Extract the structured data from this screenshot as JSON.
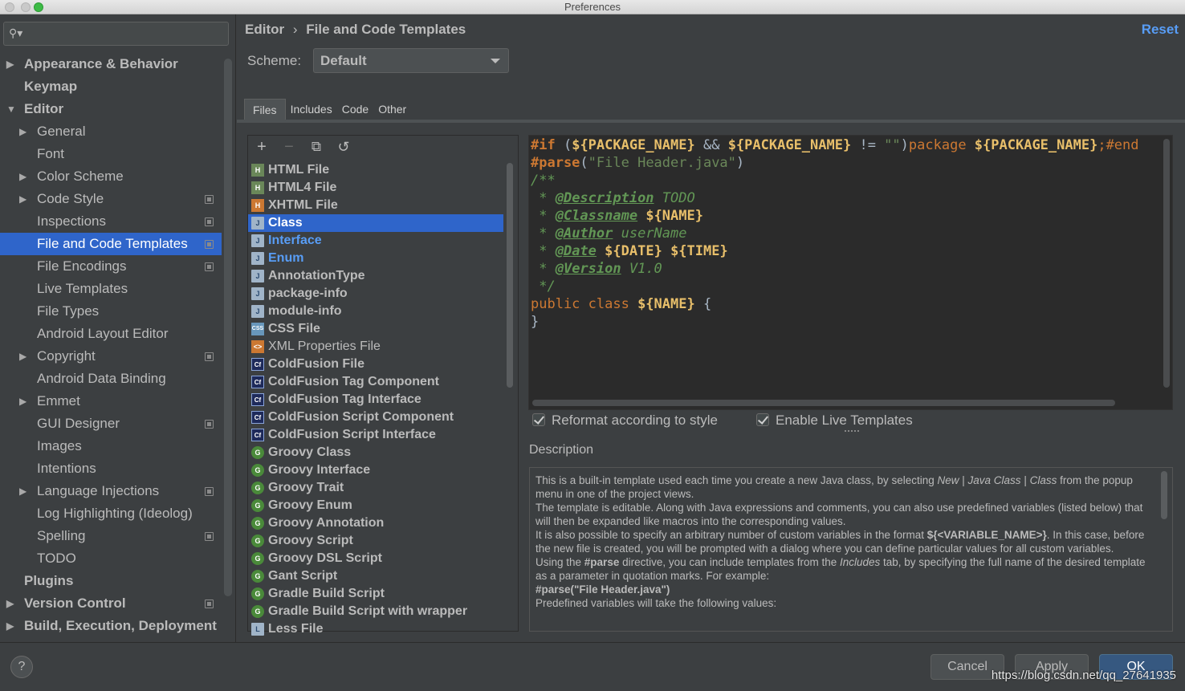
{
  "window": {
    "title": "Preferences"
  },
  "search": {
    "placeholder": ""
  },
  "sidebar": {
    "items": [
      {
        "label": "Appearance & Behavior",
        "bold": true,
        "arrow": "▶",
        "level": 0
      },
      {
        "label": "Keymap",
        "bold": true,
        "arrow": "",
        "level": 0
      },
      {
        "label": "Editor",
        "bold": true,
        "arrow": "▼",
        "level": 0
      },
      {
        "label": "General",
        "arrow": "▶",
        "level": 1
      },
      {
        "label": "Font",
        "arrow": "",
        "level": 1
      },
      {
        "label": "Color Scheme",
        "arrow": "▶",
        "level": 1
      },
      {
        "label": "Code Style",
        "arrow": "▶",
        "level": 1,
        "cfg": true
      },
      {
        "label": "Inspections",
        "arrow": "",
        "level": 1,
        "cfg": true
      },
      {
        "label": "File and Code Templates",
        "arrow": "",
        "level": 1,
        "cfg": true,
        "selected": true
      },
      {
        "label": "File Encodings",
        "arrow": "",
        "level": 1,
        "cfg": true
      },
      {
        "label": "Live Templates",
        "arrow": "",
        "level": 1
      },
      {
        "label": "File Types",
        "arrow": "",
        "level": 1
      },
      {
        "label": "Android Layout Editor",
        "arrow": "",
        "level": 1
      },
      {
        "label": "Copyright",
        "arrow": "▶",
        "level": 1,
        "cfg": true
      },
      {
        "label": "Android Data Binding",
        "arrow": "",
        "level": 1
      },
      {
        "label": "Emmet",
        "arrow": "▶",
        "level": 1
      },
      {
        "label": "GUI Designer",
        "arrow": "",
        "level": 1,
        "cfg": true
      },
      {
        "label": "Images",
        "arrow": "",
        "level": 1
      },
      {
        "label": "Intentions",
        "arrow": "",
        "level": 1
      },
      {
        "label": "Language Injections",
        "arrow": "▶",
        "level": 1,
        "cfg": true
      },
      {
        "label": "Log Highlighting (Ideolog)",
        "arrow": "",
        "level": 1
      },
      {
        "label": "Spelling",
        "arrow": "",
        "level": 1,
        "cfg": true
      },
      {
        "label": "TODO",
        "arrow": "",
        "level": 1
      },
      {
        "label": "Plugins",
        "bold": true,
        "arrow": "",
        "level": 0
      },
      {
        "label": "Version Control",
        "bold": true,
        "arrow": "▶",
        "level": 0,
        "cfg": true
      },
      {
        "label": "Build, Execution, Deployment",
        "bold": true,
        "arrow": "▶",
        "level": 0
      }
    ]
  },
  "header": {
    "breadcrumb_root": "Editor",
    "breadcrumb_sep": "›",
    "breadcrumb_page": "File and Code Templates",
    "reset_label": "Reset"
  },
  "scheme": {
    "label": "Scheme:",
    "value": "Default"
  },
  "tabs": [
    {
      "label": "Files",
      "active": true
    },
    {
      "label": "Includes"
    },
    {
      "label": "Code"
    },
    {
      "label": "Other"
    }
  ],
  "toolbar": {
    "add": "+",
    "remove": "−",
    "copy": "⧉",
    "revert": "↺"
  },
  "templates": [
    {
      "label": "HTML File",
      "icon": "html",
      "icon_text": "H"
    },
    {
      "label": "HTML4 File",
      "icon": "html4",
      "icon_text": "H"
    },
    {
      "label": "XHTML File",
      "icon": "xhtml",
      "icon_text": "H"
    },
    {
      "label": "Class",
      "icon": "java",
      "icon_text": "J",
      "selected": true
    },
    {
      "label": "Interface",
      "icon": "java",
      "icon_text": "J",
      "blue": true
    },
    {
      "label": "Enum",
      "icon": "java",
      "icon_text": "J",
      "blue": true
    },
    {
      "label": "AnnotationType",
      "icon": "java",
      "icon_text": "J"
    },
    {
      "label": "package-info",
      "icon": "java",
      "icon_text": "J"
    },
    {
      "label": "module-info",
      "icon": "java",
      "icon_text": "J"
    },
    {
      "label": "CSS File",
      "icon": "css",
      "icon_text": "CSS"
    },
    {
      "label": "XML Properties File",
      "icon": "xml",
      "icon_text": "<>",
      "plain": true
    },
    {
      "label": "ColdFusion File",
      "icon": "cf",
      "icon_text": "Cf"
    },
    {
      "label": "ColdFusion Tag Component",
      "icon": "cf",
      "icon_text": "Cf"
    },
    {
      "label": "ColdFusion Tag Interface",
      "icon": "cf",
      "icon_text": "Cf"
    },
    {
      "label": "ColdFusion Script Component",
      "icon": "cf",
      "icon_text": "Cf"
    },
    {
      "label": "ColdFusion Script Interface",
      "icon": "cf",
      "icon_text": "Cf"
    },
    {
      "label": "Groovy Class",
      "icon": "groovy",
      "icon_text": "G"
    },
    {
      "label": "Groovy Interface",
      "icon": "groovy",
      "icon_text": "G"
    },
    {
      "label": "Groovy Trait",
      "icon": "groovy",
      "icon_text": "G"
    },
    {
      "label": "Groovy Enum",
      "icon": "groovy",
      "icon_text": "G"
    },
    {
      "label": "Groovy Annotation",
      "icon": "groovy",
      "icon_text": "G"
    },
    {
      "label": "Groovy Script",
      "icon": "groovy",
      "icon_text": "G"
    },
    {
      "label": "Groovy DSL Script",
      "icon": "groovy",
      "icon_text": "G"
    },
    {
      "label": "Gant Script",
      "icon": "groovy",
      "icon_text": "G"
    },
    {
      "label": "Gradle Build Script",
      "icon": "groovy",
      "icon_text": "G"
    },
    {
      "label": "Gradle Build Script with wrapper",
      "icon": "groovy",
      "icon_text": "G"
    },
    {
      "label": "Less File",
      "icon": "java",
      "icon_text": "L"
    }
  ],
  "editor": {
    "lines": [
      [
        [
          "kw",
          "#if "
        ],
        [
          "op",
          "("
        ],
        [
          "var",
          "${PACKAGE_NAME}"
        ],
        [
          "op",
          " && "
        ],
        [
          "var",
          "${PACKAGE_NAME}"
        ],
        [
          "op",
          " != "
        ],
        [
          "str",
          "\"\""
        ],
        [
          "op",
          ")"
        ],
        [
          "dir",
          "package "
        ],
        [
          "var",
          "${PACKAGE_NAME}"
        ],
        [
          "dir",
          ";#end"
        ]
      ],
      [
        [
          "kw",
          "#parse"
        ],
        [
          "op",
          "("
        ],
        [
          "str",
          "\"File Header.java\""
        ],
        [
          "op",
          ")"
        ]
      ],
      [
        [
          "cm",
          "/**"
        ]
      ],
      [
        [
          "cm",
          " * "
        ],
        [
          "tag",
          "@Description"
        ],
        [
          "cm",
          " TODO"
        ]
      ],
      [
        [
          "cm",
          " * "
        ],
        [
          "tag",
          "@Classname"
        ],
        [
          "cm",
          " "
        ],
        [
          "var",
          "${NAME}"
        ]
      ],
      [
        [
          "cm",
          " * "
        ],
        [
          "tag",
          "@Author"
        ],
        [
          "cm",
          " userName"
        ]
      ],
      [
        [
          "cm",
          " * "
        ],
        [
          "tag",
          "@Date"
        ],
        [
          "cm",
          " "
        ],
        [
          "var",
          "${DATE}"
        ],
        [
          "cm",
          " "
        ],
        [
          "var",
          "${TIME}"
        ]
      ],
      [
        [
          "cm",
          " * "
        ],
        [
          "tag",
          "@Version"
        ],
        [
          "cm",
          " V1.0"
        ]
      ],
      [
        [
          "cm",
          " */"
        ]
      ],
      [
        [
          "dir",
          "public class "
        ],
        [
          "var",
          "${NAME}"
        ],
        [
          "op",
          " {"
        ]
      ],
      [
        [
          "op",
          "}"
        ]
      ]
    ]
  },
  "options": {
    "reformat_label": "Reformat according to style",
    "live_templates_label": "Enable Live Templates"
  },
  "description": {
    "label": "Description",
    "paragraphs": [
      [
        [
          "t",
          "This is a built-in template used each time you create a new Java class, by selecting "
        ],
        [
          "i",
          "New"
        ],
        [
          "t",
          " | "
        ],
        [
          "i",
          "Java Class"
        ],
        [
          "t",
          " | "
        ],
        [
          "i",
          "Class"
        ],
        [
          "t",
          " from the popup menu in one of the project views."
        ]
      ],
      [
        [
          "t",
          "The template is editable. Along with Java expressions and comments, you can also use predefined variables (listed below) that will then be expanded like macros into the corresponding values."
        ]
      ],
      [
        [
          "t",
          "It is also possible to specify an arbitrary number of custom variables in the format "
        ],
        [
          "b",
          "${<VARIABLE_NAME>}"
        ],
        [
          "t",
          ". In this case, before the new file is created, you will be prompted with a dialog where you can define particular values for all custom variables."
        ]
      ],
      [
        [
          "t",
          "Using the "
        ],
        [
          "b",
          "#parse"
        ],
        [
          "t",
          " directive, you can include templates from the "
        ],
        [
          "i",
          "Includes"
        ],
        [
          "t",
          " tab, by specifying the full name of the desired template as a parameter in quotation marks. For example:"
        ]
      ],
      [
        [
          "b",
          "#parse(\"File Header.java\")"
        ]
      ],
      [
        [
          "t",
          "Predefined variables will take the following values:"
        ]
      ]
    ]
  },
  "footer": {
    "help_label": "?",
    "cancel_label": "Cancel",
    "apply_label": "Apply",
    "ok_label": "OK",
    "watermark": "https://blog.csdn.net/qq_27641935"
  },
  "colors": {
    "accent": "#2f65ca",
    "link": "#589df6",
    "background": "#3c3f41",
    "editor_bg": "#2b2b2b"
  }
}
